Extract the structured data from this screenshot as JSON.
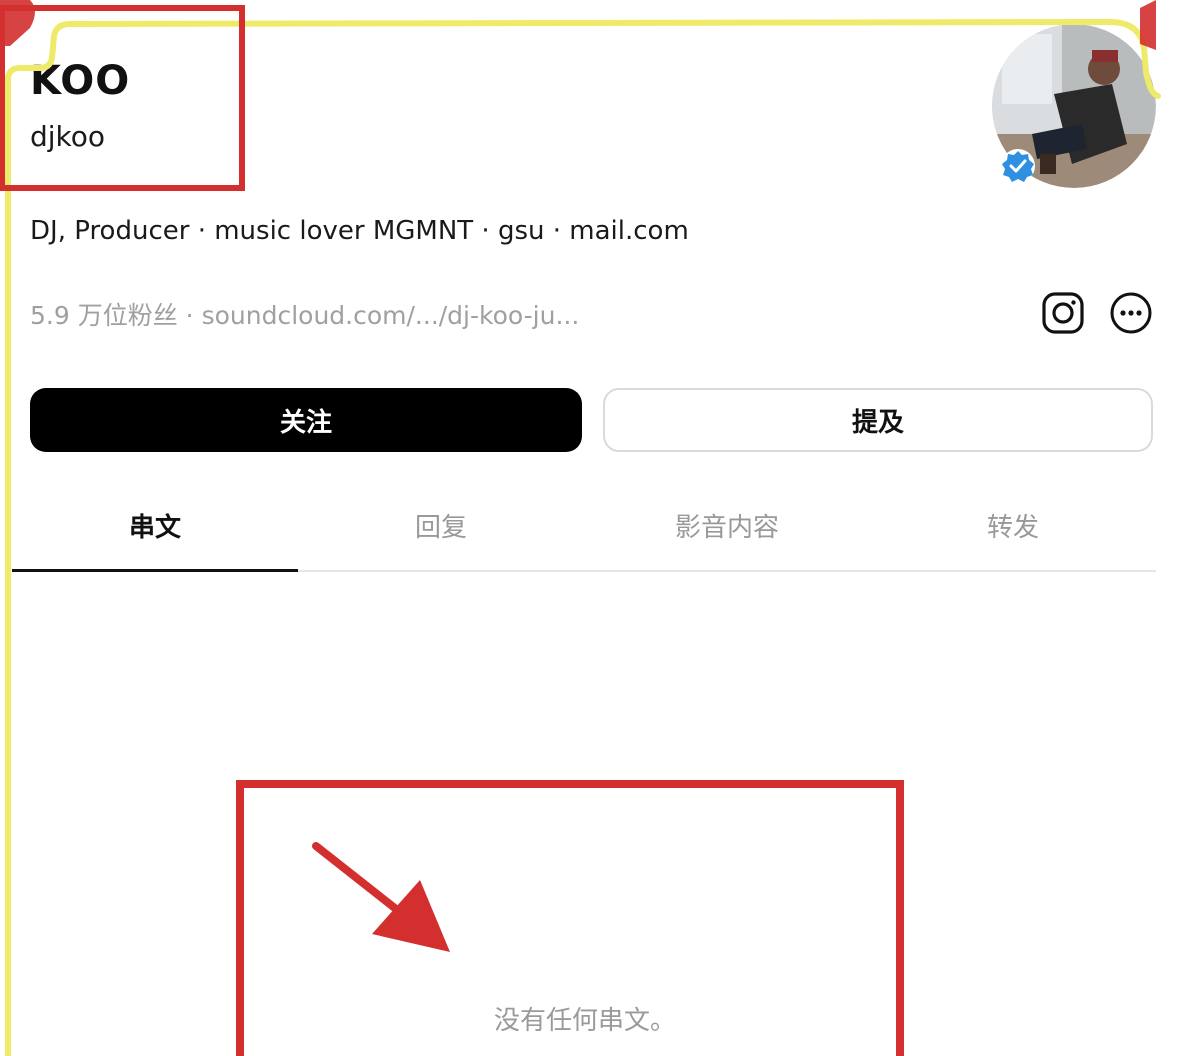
{
  "profile": {
    "display_name": "KOO",
    "username": "djkoo",
    "bio": "DJ, Producer · music lover MGMNT · gsu · mail.com",
    "followers": "5.9 万位粉丝",
    "separator": "·",
    "link": "soundcloud.com/.../dj-koo-ju...",
    "verified": true
  },
  "actions": {
    "follow_label": "关注",
    "mention_label": "提及"
  },
  "icons": {
    "instagram": "instagram-icon",
    "more": "more-options-icon",
    "verified": "verified-badge-icon"
  },
  "tabs": [
    {
      "label": "串文",
      "active": true
    },
    {
      "label": "回复",
      "active": false
    },
    {
      "label": "影音内容",
      "active": false
    },
    {
      "label": "转发",
      "active": false
    }
  ],
  "empty_state": {
    "message": "没有任何串文。"
  },
  "colors": {
    "annotation_red": "#d32f2f",
    "annotation_yellow": "#eeea6a",
    "verified_blue": "#2f8fe0",
    "primary_button": "#000000"
  }
}
